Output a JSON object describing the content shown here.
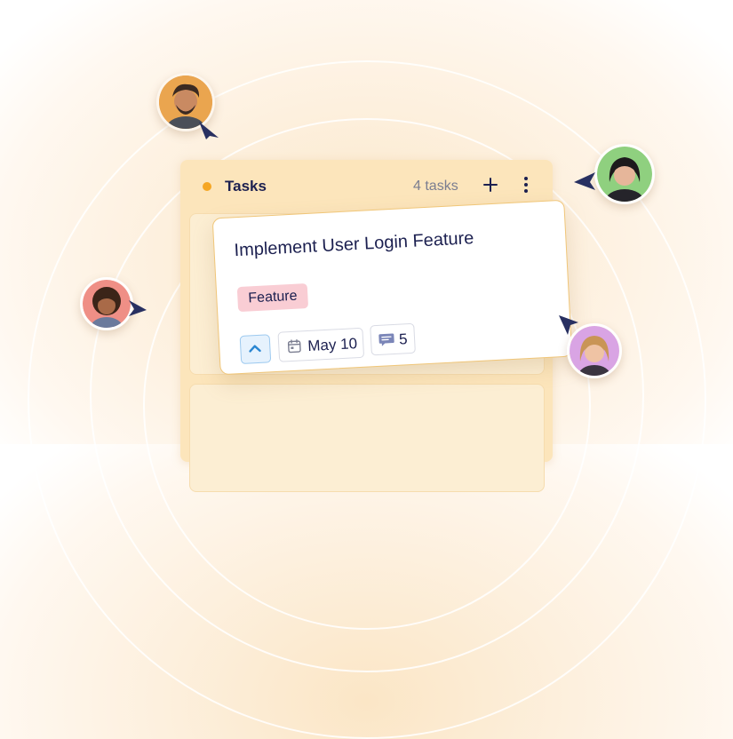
{
  "column": {
    "title": "Tasks",
    "status_color": "#f5a623",
    "task_count": "4 tasks",
    "add_icon": "plus-icon",
    "more_icon": "more-vertical-icon"
  },
  "card": {
    "title": "Implement User Login Feature",
    "tag": "Feature",
    "tag_color": "#f9cdd4",
    "priority_icon": "chevron-up-icon",
    "date": "May 10",
    "date_icon": "calendar-icon",
    "comments": "5",
    "comment_icon": "comment-icon"
  },
  "colors": {
    "accent_border": "#f0c679",
    "text": "#1c2050",
    "cursor": "#283061"
  }
}
